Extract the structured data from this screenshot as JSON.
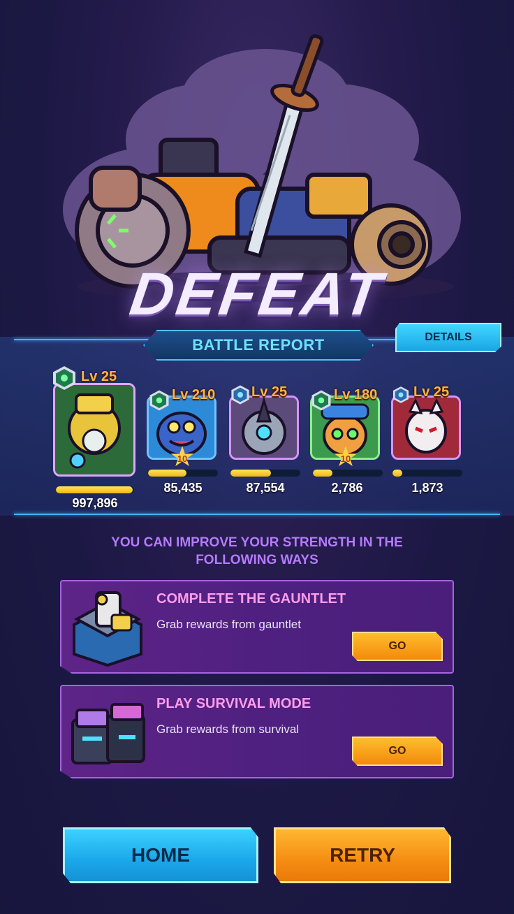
{
  "result": {
    "title": "DEFEAT"
  },
  "report": {
    "header": "BATTLE REPORT",
    "details_label": "DETAILS",
    "heroes": [
      {
        "level": "Lv 25",
        "damage": "997,896",
        "bar": 0.98,
        "stars": "",
        "badge": "green"
      },
      {
        "level": "Lv 210",
        "damage": "85,435",
        "bar": 0.55,
        "stars": "10",
        "badge": "green"
      },
      {
        "level": "Lv 25",
        "damage": "87,554",
        "bar": 0.58,
        "stars": "",
        "badge": "blue"
      },
      {
        "level": "Lv 180",
        "damage": "2,786",
        "bar": 0.28,
        "stars": "10",
        "badge": "green"
      },
      {
        "level": "Lv 25",
        "damage": "1,873",
        "bar": 0.14,
        "stars": "",
        "badge": "blue"
      }
    ]
  },
  "improve": {
    "title_line1": "YOU CAN IMPROVE YOUR STRENGTH IN THE",
    "title_line2": "FOLLOWING WAYS",
    "tips": [
      {
        "title": "COMPLETE THE GAUNTLET",
        "desc": "Grab rewards from gauntlet",
        "go_label": "GO"
      },
      {
        "title": "PLAY SURVIVAL MODE",
        "desc": "Grab rewards from survival",
        "go_label": "GO"
      }
    ]
  },
  "actions": {
    "home_label": "HOME",
    "retry_label": "RETRY"
  },
  "colors": {
    "accent_cyan": "#3fb6ff",
    "accent_orange": "#f58d12",
    "purple": "#5e2488"
  }
}
